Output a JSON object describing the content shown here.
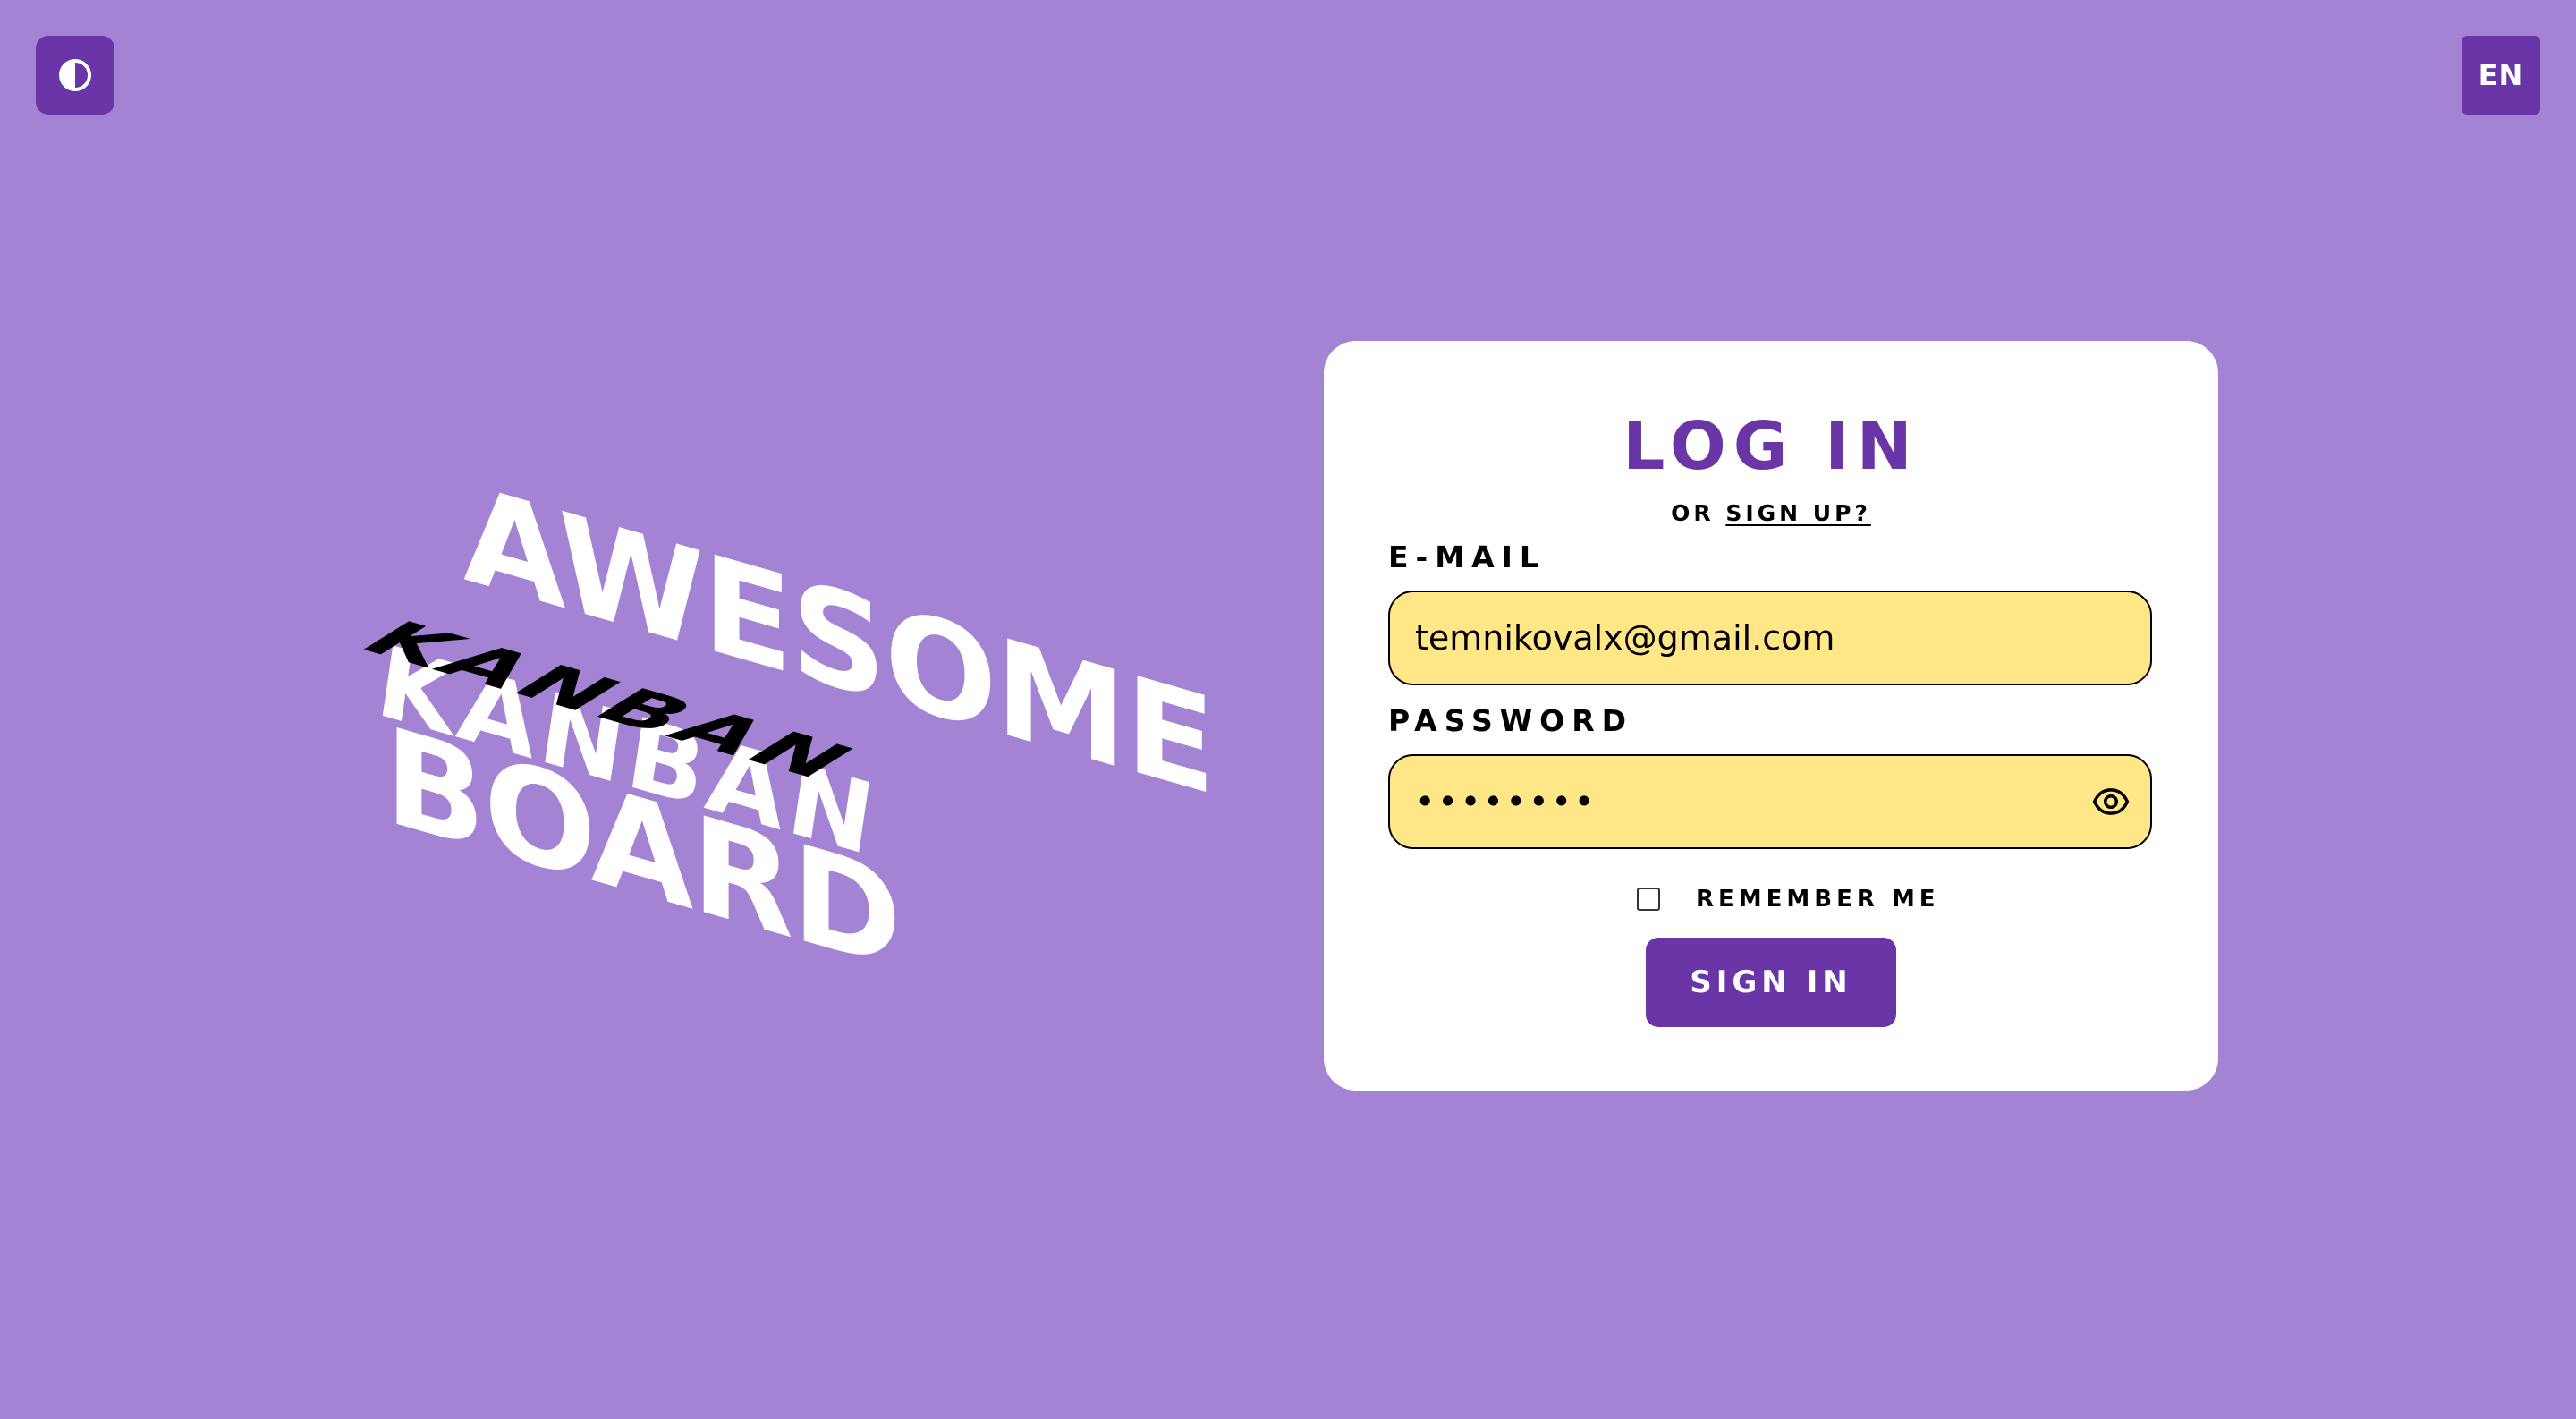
{
  "header": {
    "theme_icon": "contrast-icon",
    "language_label": "EN"
  },
  "hero": {
    "line1": "AWESOME",
    "line2": "KANBAN",
    "line3": "BOARD"
  },
  "login": {
    "title": "LOG IN",
    "or_text": "OR ",
    "signup_link": "SIGN UP?",
    "email_label": "E-MAIL",
    "email_value": "temnikovalx@gmail.com",
    "password_label": "PASSWORD",
    "password_value": "••••••••",
    "show_password_icon": "eye-icon",
    "remember_label": "REMEMBER ME",
    "remember_checked": false,
    "signin_label": "SIGN IN"
  },
  "colors": {
    "background": "#a583d4",
    "accent": "#6a35a6",
    "input_fill": "#ffe686",
    "card": "#ffffff"
  }
}
